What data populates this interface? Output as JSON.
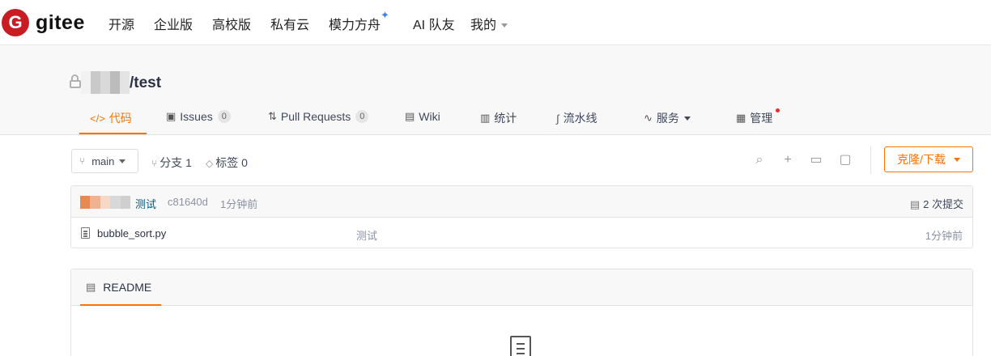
{
  "brand": {
    "logo_letter": "G",
    "name": "gitee",
    "color": "#c71d23"
  },
  "topnav": {
    "items": [
      "开源",
      "企业版",
      "高校版",
      "私有云",
      "模力方舟",
      "AI 队友",
      "我的"
    ],
    "spark": "✦"
  },
  "repo": {
    "name": "/test",
    "visibility_icon": "unlock-icon",
    "tabs": [
      {
        "label": "代码",
        "icon": "</>",
        "active": true
      },
      {
        "label": "Issues",
        "badge": "0"
      },
      {
        "label": "Pull Requests",
        "badge": "0"
      },
      {
        "label": "Wiki"
      },
      {
        "label": "统计"
      },
      {
        "label": "流水线"
      },
      {
        "label": "服务"
      },
      {
        "label": "管理"
      }
    ]
  },
  "toolbar": {
    "branch": "main",
    "branches_label": "分支 1",
    "tags_label": "标签 0",
    "clone_label": "克隆/下载"
  },
  "commit": {
    "message": "测试",
    "hash": "c81640d",
    "time": "1分钟前",
    "count_label": "2 次提交"
  },
  "files": [
    {
      "name": "bubble_sort.py",
      "commit_message": "测试",
      "time": "1分钟前"
    }
  ],
  "readme": {
    "tab_label": "README"
  },
  "colors": {
    "accent": "#fe7300",
    "link": "#005980"
  }
}
